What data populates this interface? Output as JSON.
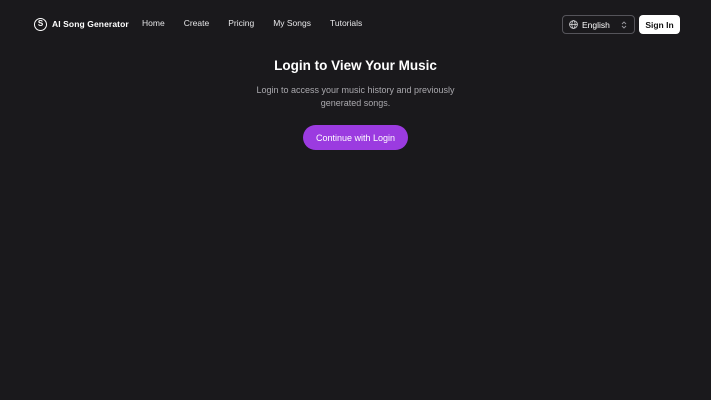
{
  "brand": {
    "logo_letter": "S",
    "name": "AI Song Generator"
  },
  "nav": {
    "items": [
      {
        "label": "Home"
      },
      {
        "label": "Create"
      },
      {
        "label": "Pricing"
      },
      {
        "label": "My Songs"
      },
      {
        "label": "Tutorials"
      }
    ]
  },
  "language": {
    "selected": "English",
    "icon": "globe-icon"
  },
  "signin": {
    "label": "Sign In"
  },
  "main": {
    "title": "Login to View Your Music",
    "description": "Login to access your music history and previously generated songs.",
    "cta_label": "Continue with Login"
  },
  "colors": {
    "background": "#1a191c",
    "accent": "#9b3be0",
    "muted_text": "#a9a8ad",
    "select_border": "#55545a"
  }
}
